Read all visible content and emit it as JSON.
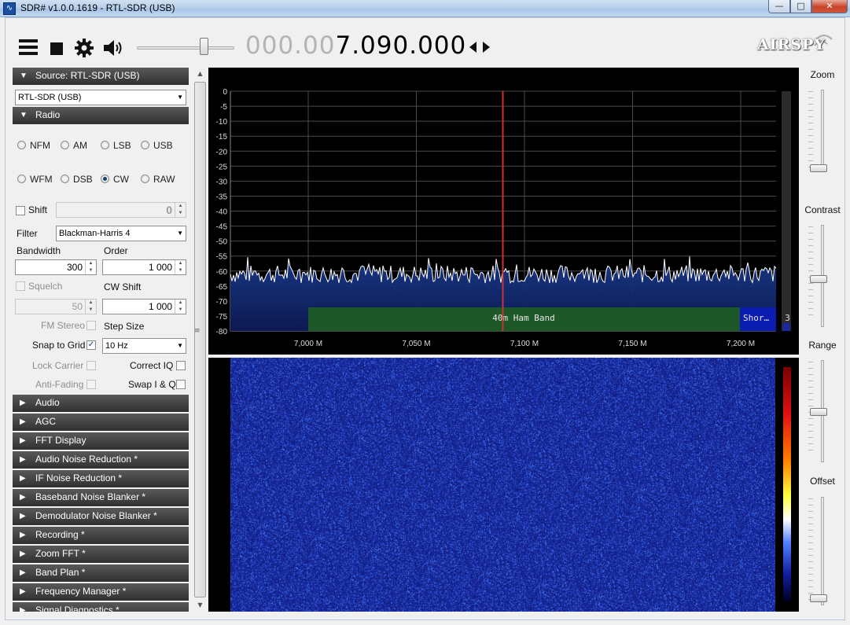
{
  "window": {
    "title": "SDR# v1.0.0.1619 - RTL-SDR (USB)",
    "min_symbol": "—",
    "max_symbol": "□",
    "close_symbol": "✕"
  },
  "toolbar": {
    "frequency_dim": "000.00",
    "frequency_bright": "7.090.000",
    "volume_level": 0.72,
    "logo": "AIRSPY"
  },
  "source": {
    "header": "Source: RTL-SDR (USB)",
    "device": "RTL-SDR (USB)"
  },
  "radio": {
    "header": "Radio",
    "modes_row1": [
      "NFM",
      "AM",
      "LSB",
      "USB"
    ],
    "modes_row2": [
      "WFM",
      "DSB",
      "CW",
      "RAW"
    ],
    "selected_mode": "CW",
    "shift_label": "Shift",
    "shift_value": "0",
    "filter_label": "Filter",
    "filter_value": "Blackman-Harris 4",
    "bandwidth_label": "Bandwidth",
    "bandwidth_value": "300",
    "order_label": "Order",
    "order_value": "1 000",
    "squelch_label": "Squelch",
    "squelch_value": "50",
    "cwshift_label": "CW Shift",
    "cwshift_value": "1 000",
    "fmstereo_label": "FM Stereo",
    "stepsize_label": "Step Size",
    "snap_label": "Snap to Grid",
    "snap_checked": true,
    "step_value": "10 Hz",
    "lockcarrier_label": "Lock Carrier",
    "correctiq_label": "Correct IQ",
    "antifading_label": "Anti-Fading",
    "swapiq_label": "Swap I & Q"
  },
  "collapsed_sections": [
    "Audio",
    "AGC",
    "FFT Display",
    "Audio Noise Reduction *",
    "IF Noise Reduction *",
    "Baseband Noise Blanker *",
    "Demodulator Noise Blanker *",
    "Recording *",
    "Zoom FFT *",
    "Band Plan *",
    "Frequency Manager *",
    "Signal Diagnostics *"
  ],
  "spectrum": {
    "y_ticks": [
      "0",
      "-5",
      "-10",
      "-15",
      "-20",
      "-25",
      "-30",
      "-35",
      "-40",
      "-45",
      "-50",
      "-55",
      "-60",
      "-65",
      "-70",
      "-75",
      "-80"
    ],
    "x_ticks": [
      "7,000 M",
      "7,050 M",
      "7,100 M",
      "7,150 M",
      "7,200 M"
    ],
    "band_label": "40m Ham Band",
    "band2_label": "Shor…",
    "scale_value": "3",
    "noise_floor_db": -61,
    "grid_color": "#4a4a4a",
    "trace_color": "#ffffff",
    "marker_color": "#cc3333",
    "band_color": "#1f5e22",
    "band2_color": "#0b1cb0"
  },
  "waterfall": {
    "base_color": "#1a2a9c",
    "speckle_color": "#6fa0ff"
  },
  "right_controls": {
    "zoom_label": "Zoom",
    "contrast_label": "Contrast",
    "range_label": "Range",
    "offset_label": "Offset"
  }
}
